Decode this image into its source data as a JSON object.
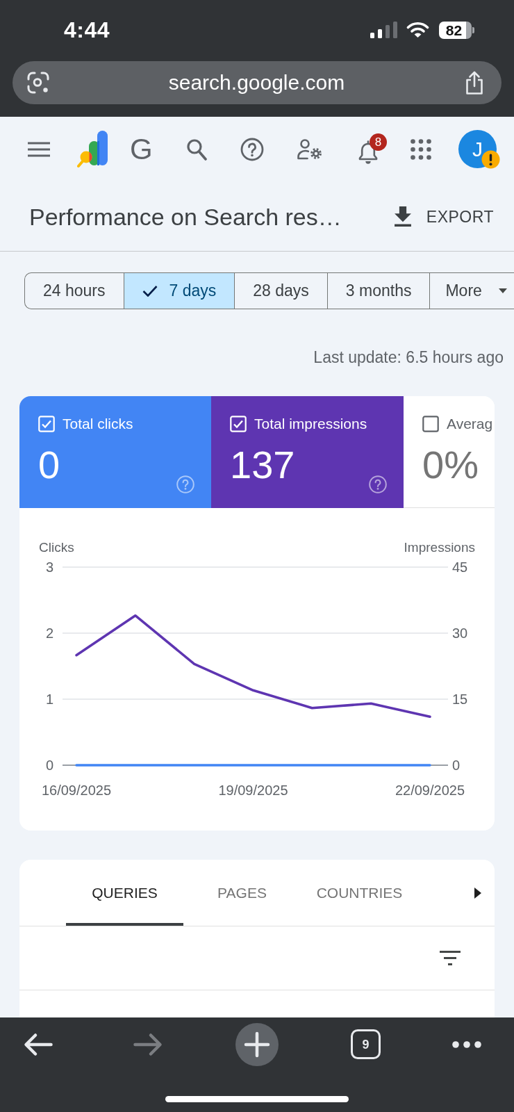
{
  "status_bar": {
    "time": "4:44",
    "battery": "82"
  },
  "address_bar": {
    "url": "search.google.com"
  },
  "toolbar": {
    "app_name": "G",
    "notification_count": "8",
    "avatar_letter": "J",
    "avatar_warning": true
  },
  "header": {
    "title": "Performance on Search res…",
    "export_label": "EXPORT"
  },
  "date_ranges": [
    {
      "label": "24 hours",
      "selected": false,
      "kind": "option"
    },
    {
      "label": "7 days",
      "selected": true,
      "kind": "option"
    },
    {
      "label": "28 days",
      "selected": false,
      "kind": "option"
    },
    {
      "label": "3 months",
      "selected": false,
      "kind": "option"
    },
    {
      "label": "More",
      "selected": false,
      "kind": "dropdown"
    }
  ],
  "last_update": "Last update: 6.5 hours ago",
  "metrics": [
    {
      "label": "Total clicks",
      "value": "0",
      "checked": true,
      "color": "#4285f4"
    },
    {
      "label": "Total impressions",
      "value": "137",
      "checked": true,
      "color": "#5e35b1"
    },
    {
      "label": "Averag",
      "value": "0%",
      "checked": false
    }
  ],
  "chart": {
    "chart_data": {
      "type": "line",
      "ylabel": "Clicks",
      "y2label": "Impressions",
      "categories": [
        "16/09/2025",
        null,
        null,
        "19/09/2025",
        null,
        null,
        "22/09/2025"
      ],
      "ylim": [
        0,
        3
      ],
      "yticks": [
        0,
        1,
        2,
        3
      ],
      "y2lim": [
        0,
        45
      ],
      "y2ticks": [
        0,
        15,
        30,
        45
      ],
      "series": [
        {
          "color": "#4285f4",
          "values": [
            0,
            0,
            0,
            0,
            0,
            0,
            0
          ]
        },
        {
          "color": "#5e35b1",
          "axis": "y2",
          "values": [
            25,
            34,
            23,
            17,
            13,
            14,
            11
          ]
        }
      ]
    }
  },
  "report_tabs": [
    {
      "label": "QUERIES",
      "selected": true
    },
    {
      "label": "PAGES",
      "selected": false
    },
    {
      "label": "COUNTRIES",
      "selected": false
    }
  ],
  "browser_toolbar": {
    "buttons": [
      {
        "kind": "back",
        "disabled": false
      },
      {
        "kind": "forward",
        "disabled": true
      },
      {
        "kind": "new_tab",
        "disabled": false
      },
      {
        "kind": "tabs",
        "disabled": false,
        "label": "9"
      },
      {
        "kind": "more",
        "disabled": false
      }
    ]
  }
}
